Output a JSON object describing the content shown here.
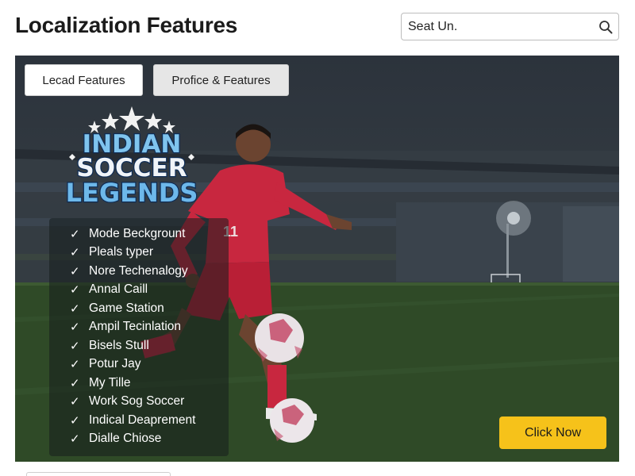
{
  "header": {
    "title": "Localization Features"
  },
  "search": {
    "value": "Seat Un.",
    "icon": "search-icon"
  },
  "hero": {
    "tabs": [
      {
        "label": "Lecad Features",
        "active": true
      },
      {
        "label": "Profice & Features",
        "active": false
      }
    ],
    "logo": {
      "lines": [
        "INDIAN",
        "SOCCER",
        "LEGENDS"
      ]
    },
    "player_number": "11",
    "features": [
      "Mode Beckgrount",
      "Pleals typer",
      "Nore Techenalogy",
      "Annal Caill",
      "Game Station",
      "Ampil Tecinlation",
      "Bisels Stull",
      "Potur Jay",
      "My Tille",
      "Work Sog Soccer",
      "Indical Deaprement",
      "Dialle Chiose"
    ],
    "cta_label": "Click Now"
  },
  "colors": {
    "accent": "#f6c21a",
    "jersey": "#c8273f",
    "pitch": "#2f4a27"
  }
}
